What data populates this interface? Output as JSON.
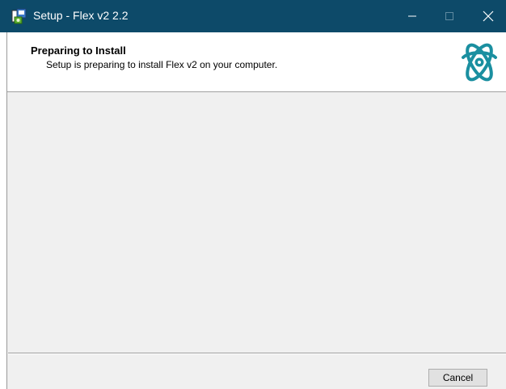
{
  "window": {
    "title": "Setup - Flex v2 2.2",
    "icons": {
      "app": "installer-app-icon",
      "minimize": "minimize-icon",
      "maximize": "maximize-icon",
      "close": "close-icon",
      "logo": "flex-atom-logo-icon"
    },
    "colors": {
      "titlebar": "#0d4a69",
      "logo": "#1a8fa0"
    }
  },
  "header": {
    "title": "Preparing to Install",
    "subtitle": "Setup is preparing to install Flex v2 on your computer."
  },
  "footer": {
    "cancel_label": "Cancel"
  }
}
